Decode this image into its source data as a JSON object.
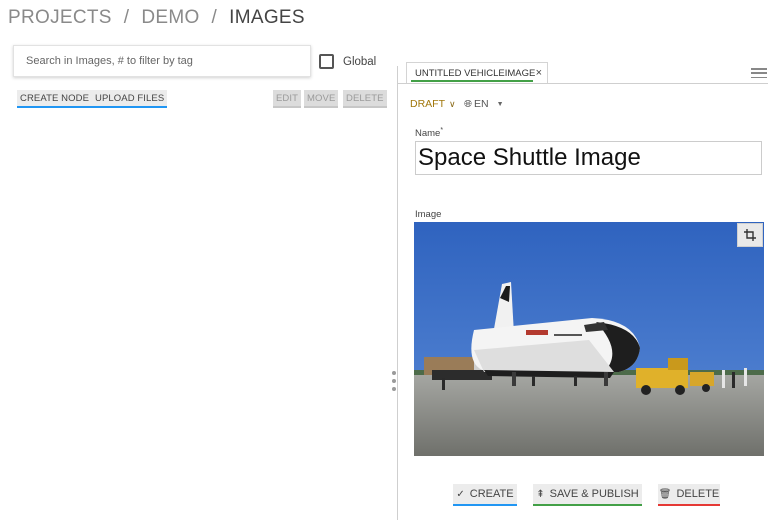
{
  "breadcrumb": {
    "items": [
      "PROJECTS",
      "DEMO"
    ],
    "current": "IMAGES",
    "separator": "/"
  },
  "search": {
    "placeholder": "Search in Images, # to filter by tag",
    "value": ""
  },
  "global_toggle": {
    "label": "Global",
    "checked": false
  },
  "node_toolbar": {
    "create_node": "CREATE NODE",
    "upload_files": "UPLOAD FILES",
    "edit": "EDIT",
    "move": "MOVE",
    "delete": "DELETE"
  },
  "editor": {
    "tab_title": "UNTITLED VEHICLEIMAGE",
    "tab_close": "×",
    "status": "DRAFT",
    "status_caret": "∨",
    "language": "EN",
    "name_label": "Name",
    "name_required_mark": "*",
    "name_value": "Space Shuttle Image",
    "image_label": "Image",
    "image_icon": "crop-icon"
  },
  "actions": {
    "create": {
      "label": "CREATE",
      "icon": "✓",
      "color": "#2196f3"
    },
    "save_publish": {
      "label": "SAVE & PUBLISH",
      "icon": "⇞",
      "color": "#43a047"
    },
    "delete": {
      "label": "DELETE",
      "icon": "🗑",
      "color": "#e53935"
    }
  },
  "colors": {
    "accent_blue": "#2196f3",
    "accent_green": "#43a047",
    "accent_red": "#e53935",
    "draft": "#a1770b"
  }
}
